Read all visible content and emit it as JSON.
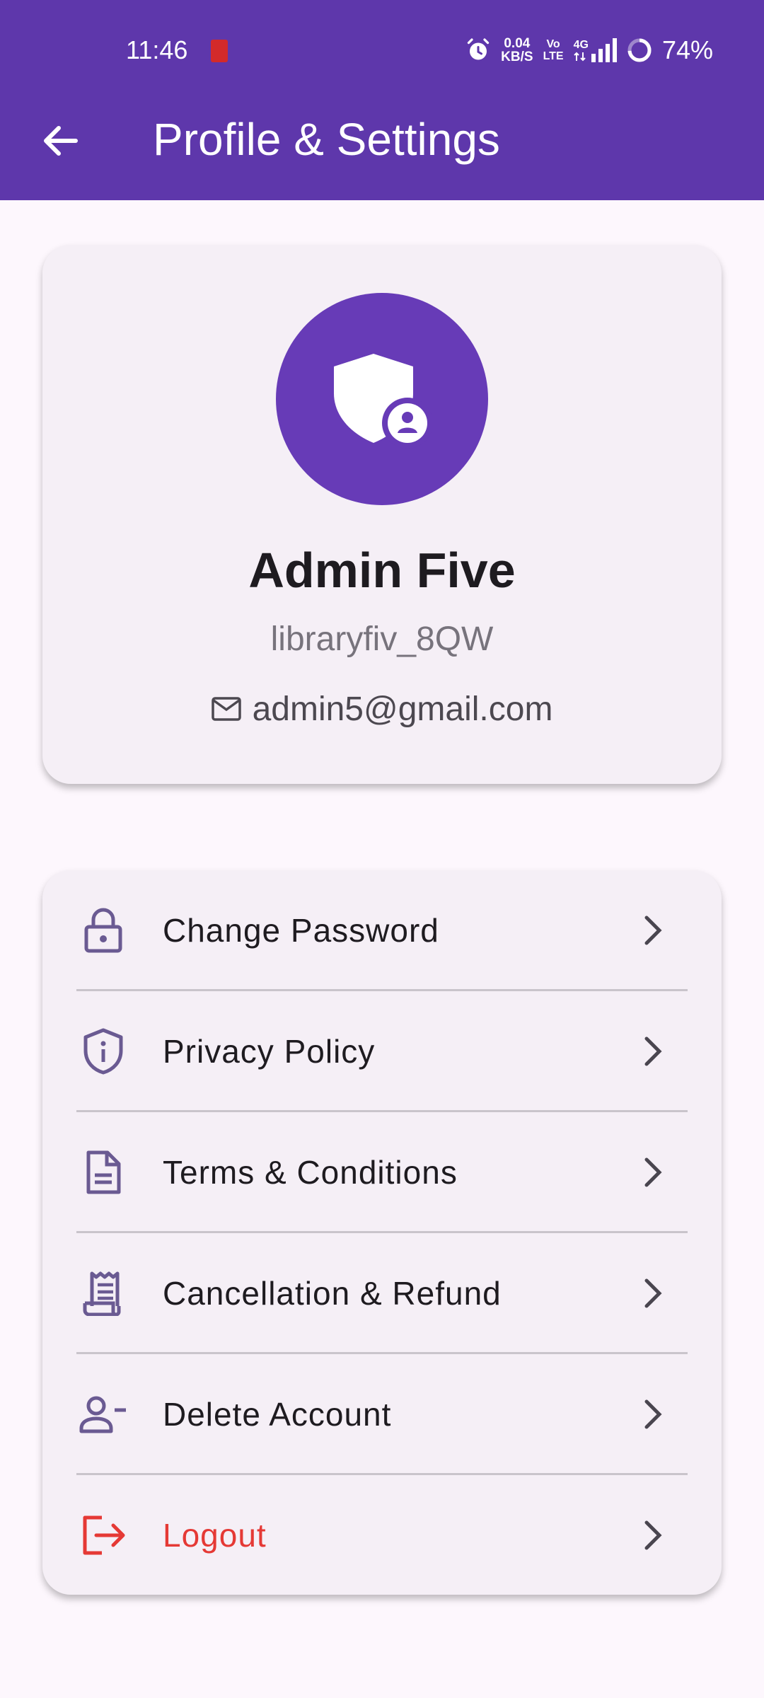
{
  "status_bar": {
    "time": "11:46",
    "net_speed_value": "0.04",
    "net_speed_unit": "KB/S",
    "volte_top": "Vo",
    "volte_bottom": "LTE",
    "network_type": "4G",
    "battery_percent": "74%"
  },
  "app_bar": {
    "title": "Profile & Settings",
    "back_icon": "arrow-left-icon"
  },
  "profile": {
    "avatar_icon": "admin-shield-icon",
    "name": "Admin Five",
    "username": "libraryfiv_8QW",
    "email": "admin5@gmail.com",
    "email_icon": "mail-icon"
  },
  "menu": [
    {
      "label": "Change Password",
      "icon": "lock-icon"
    },
    {
      "label": "Privacy Policy",
      "icon": "shield-info-icon"
    },
    {
      "label": "Terms & Conditions",
      "icon": "document-icon"
    },
    {
      "label": "Cancellation & Refund",
      "icon": "receipt-icon"
    },
    {
      "label": "Delete Account",
      "icon": "person-remove-icon"
    },
    {
      "label": "Logout",
      "icon": "logout-icon"
    }
  ],
  "colors": {
    "primary": "#5e37ab",
    "avatar_bg": "#673bb7",
    "menu_icon": "#6a5a92",
    "danger": "#e53935",
    "background": "#fdf7fd",
    "card": "#f5eff6"
  }
}
